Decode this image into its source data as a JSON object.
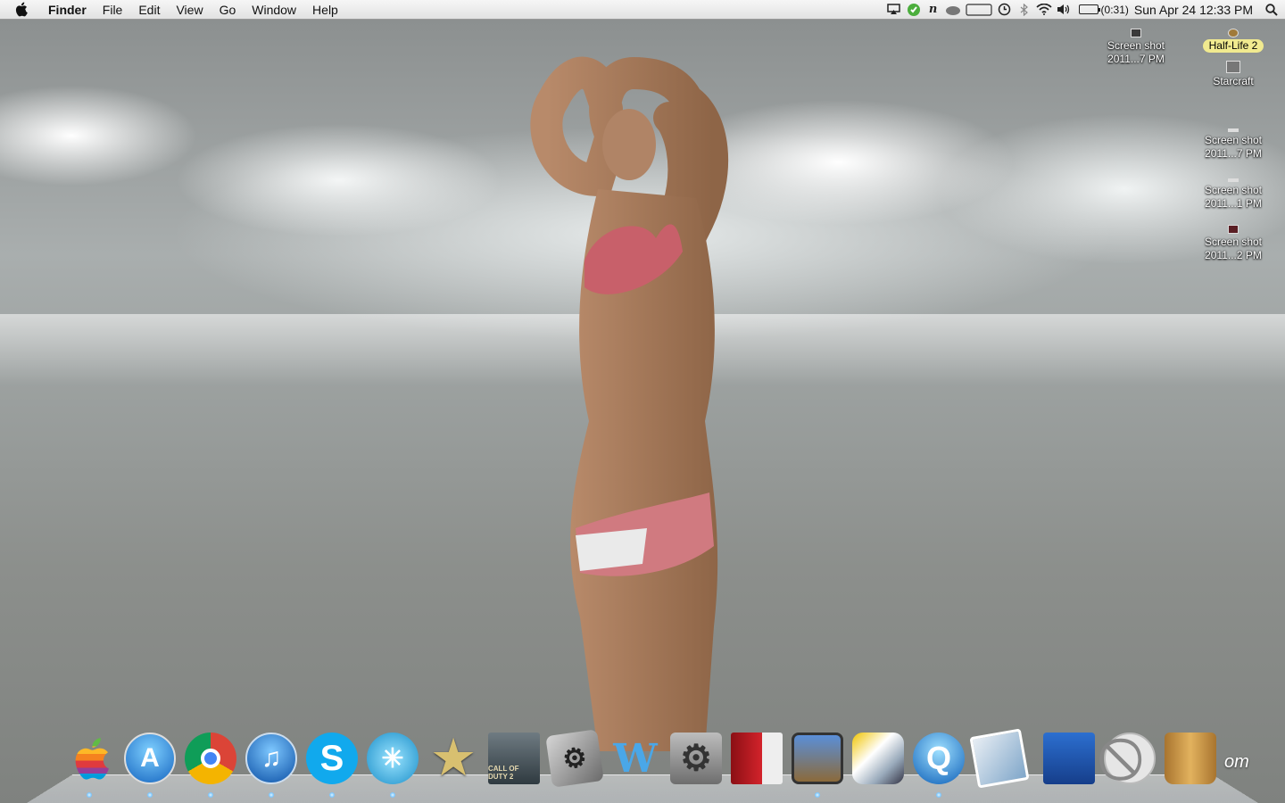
{
  "menubar": {
    "app_name": "Finder",
    "menus": [
      "File",
      "Edit",
      "View",
      "Go",
      "Window",
      "Help"
    ],
    "battery_time": "(0:31)",
    "datetime": "Sun Apr 24  12:33 PM",
    "tray_icons": [
      "airplay-icon",
      "evernote-icon",
      "n-icon",
      "cloud-icon",
      "display-icon",
      "time-machine-icon",
      "bluetooth-icon",
      "wifi-icon",
      "volume-icon",
      "battery-icon",
      "spotlight-icon"
    ]
  },
  "desktop": {
    "icons": [
      {
        "line1": "Screen shot",
        "line2": "2011...7 PM"
      },
      {
        "line1": "Half-Life 2",
        "line2": ""
      },
      {
        "line1": "Starcraft",
        "line2": ""
      },
      {
        "line1": "Screen shot",
        "line2": "2011...7 PM"
      },
      {
        "line1": "Screen shot",
        "line2": "2011...1 PM"
      },
      {
        "line1": "Screen shot",
        "line2": "2011...2 PM"
      }
    ]
  },
  "dock": {
    "apps": [
      {
        "name": "finder-icon",
        "glyph": ""
      },
      {
        "name": "app-store-icon",
        "glyph": "A"
      },
      {
        "name": "chrome-icon",
        "glyph": ""
      },
      {
        "name": "itunes-icon",
        "glyph": "♫"
      },
      {
        "name": "skype-icon",
        "glyph": "S"
      },
      {
        "name": "frostwire-icon",
        "glyph": "✳"
      },
      {
        "name": "imovie-icon",
        "glyph": "★"
      },
      {
        "name": "call-of-duty-2-icon",
        "glyph": "CALL OF DUTY 2"
      },
      {
        "name": "steam-icon",
        "glyph": "⚙"
      },
      {
        "name": "wunderlist-icon",
        "glyph": "W"
      },
      {
        "name": "system-preferences-icon",
        "glyph": "⚙"
      },
      {
        "name": "photo-booth-icon",
        "glyph": ""
      },
      {
        "name": "game-icon",
        "glyph": ""
      },
      {
        "name": "character-icon",
        "glyph": ""
      },
      {
        "name": "quicktime-icon",
        "glyph": "Q"
      },
      {
        "name": "iphoto-icon",
        "glyph": ""
      },
      {
        "name": "vuze-icon",
        "glyph": ""
      },
      {
        "name": "no-entry-icon",
        "glyph": "⃠"
      },
      {
        "name": "trash-icon",
        "glyph": ""
      }
    ],
    "trailing_text": "om"
  }
}
